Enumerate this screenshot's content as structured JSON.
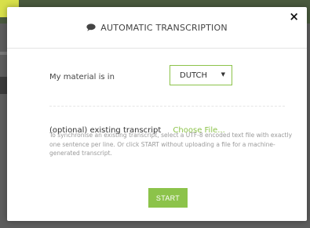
{
  "modal": {
    "title": "AUTOMATIC TRANSCRIPTION",
    "title_icon": "chat-bubble-icon",
    "close_label": "×",
    "close_icon": "close-icon"
  },
  "language": {
    "label": "My material is in",
    "selected": "DUTCH"
  },
  "transcript": {
    "label": "(optional) existing transcript",
    "choose_file": "Choose File...",
    "help": "To synchronise an existing transcript, select a UTF-8 encoded text file with exactly one sentence per line. Or click START without uploading a file for a machine-generated transcript."
  },
  "actions": {
    "start_label": "START"
  },
  "colors": {
    "accent": "#8cc34a",
    "overlay": "#5d5d5d"
  }
}
